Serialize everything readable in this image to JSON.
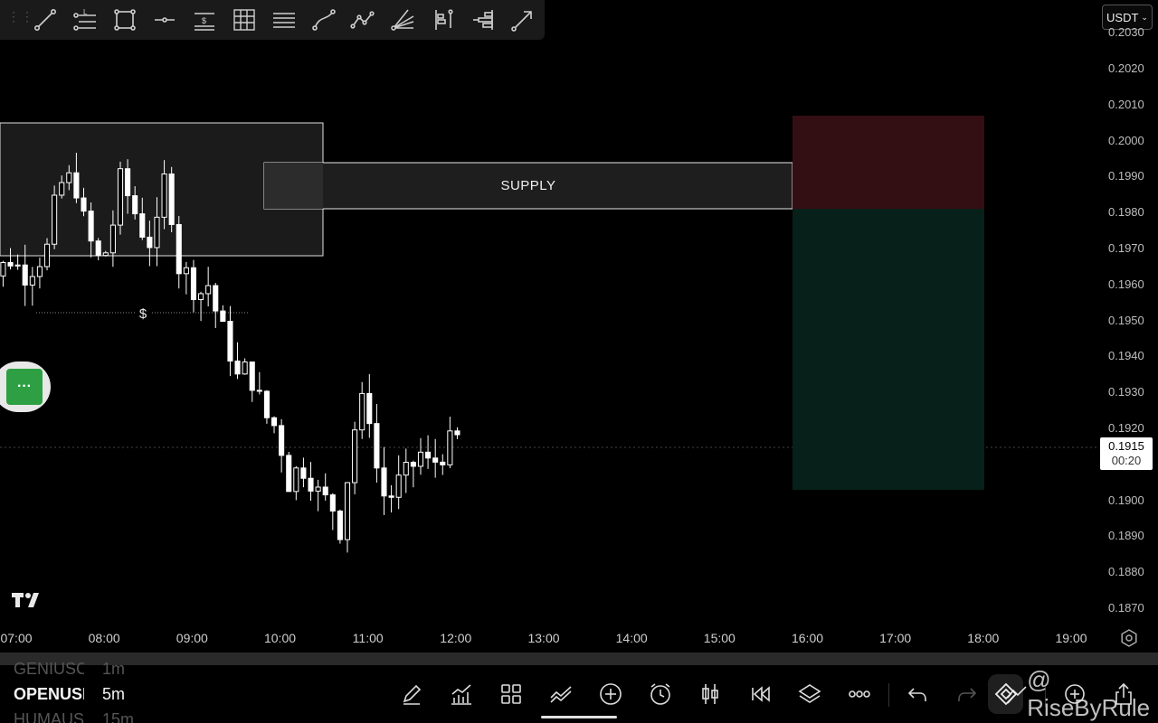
{
  "toolbar": {
    "tools": [
      {
        "icon": "trend-line-icon"
      },
      {
        "icon": "price-label-icon",
        "glyph": "L"
      },
      {
        "icon": "rectangle-icon"
      },
      {
        "icon": "horizontal-line-icon"
      },
      {
        "icon": "price-note-icon",
        "glyph": "$"
      },
      {
        "icon": "grid-table-icon"
      },
      {
        "icon": "parallel-channel-icon"
      },
      {
        "icon": "curve-icon"
      },
      {
        "icon": "polyline-icon"
      },
      {
        "icon": "fib-fan-icon"
      },
      {
        "icon": "long-position-icon"
      },
      {
        "icon": "volume-profile-icon"
      },
      {
        "icon": "arrow-tool-icon"
      }
    ]
  },
  "currency": {
    "label": "USDT",
    "icon": "chevron-down-icon"
  },
  "chart_data": {
    "type": "candlestick",
    "price_ticks": [
      "0.2030",
      "0.2020",
      "0.2010",
      "0.2000",
      "0.1990",
      "0.1980",
      "0.1970",
      "0.1960",
      "0.1950",
      "0.1940",
      "0.1930",
      "0.1920",
      "0.1910",
      "0.1900",
      "0.1890",
      "0.1880",
      "0.1870"
    ],
    "time_ticks": [
      "07:00",
      "08:00",
      "09:00",
      "10:00",
      "11:00",
      "12:00",
      "13:00",
      "14:00",
      "15:00",
      "16:00",
      "17:00",
      "18:00",
      "19:00"
    ],
    "ylim": [
      0.1865,
      0.203
    ],
    "last_price": "0.1915",
    "countdown": "00:20",
    "zone_label": "SUPPLY",
    "liquidity_symbol": "$",
    "colors": {
      "candle": "#ffffff",
      "stop_zone": "#330f14",
      "target_zone": "#08201a",
      "zone_fill": "#1c1c1c"
    }
  },
  "floating_menu": {
    "label": "···"
  },
  "logo": {
    "icon": "tradingview-logo-icon"
  },
  "timeframe_picker": {
    "prev": {
      "symbol": "GENIUSC",
      "tf": "1m"
    },
    "selected": {
      "symbol": "OPENUSI",
      "tf": "5m"
    },
    "next": {
      "symbol": "HUMAUS",
      "tf": "15m"
    }
  },
  "bottom_toolbar": {
    "icons": [
      "pencil-icon",
      "indicators-icon",
      "apps-grid-icon",
      "drawings-icon",
      "add-circle-icon",
      "alert-clock-icon",
      "candles-icon",
      "replay-icon",
      "layers-icon",
      "more-icon",
      "undo-icon",
      "redo-icon",
      "sync-icon",
      "zoom-icon",
      "share-icon"
    ]
  },
  "watermark": {
    "text": "@ RiseByRule"
  }
}
